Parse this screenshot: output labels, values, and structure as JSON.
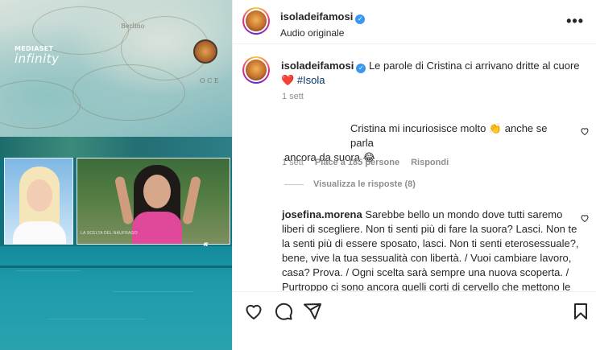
{
  "media": {
    "mediaset_line1": "MEDIASET",
    "mediaset_line2": "infinity",
    "caption_small": "LA SCELTA DEL NAUFRAGO",
    "channel": "5",
    "map_words": [
      "O C E",
      "Berlino"
    ]
  },
  "header": {
    "username": "isoladeifamosi",
    "subtitle": "Audio originale",
    "more_label": "•••"
  },
  "post_caption": {
    "username": "isoladeifamosi",
    "text": "Le parole di Cristina ci arrivano dritte al cuore",
    "heart": "❤️",
    "hashtag": "#Isola",
    "time": "1 sett"
  },
  "comment1": {
    "line1": "Cristina mi incuriosisce molto 👏 anche se parla",
    "line2": "ancora da suora 😂",
    "time": "1 sett",
    "likes": "Piace a 185 persone",
    "reply": "Rispondi",
    "view_replies": "Visualizza le risposte (8)"
  },
  "comment2": {
    "username": "josefina.morena",
    "line1": "Sarebbe bello un mondo dove tutti saremo",
    "line2": "liberi di scegliere. Non ti senti più di fare la suora? Lasci. Non te",
    "line3": "la senti più di essere sposato, lasci. Non ti senti eterosessuale?,",
    "line4": "bene, vive la tua sessualità con libertà. / Vuoi cambiare lavoro,",
    "line5": "casa? Prova. / Ogni scelta sarà sempre una nuova scoperta. /",
    "line6": "Purtroppo ci sono ancora quelli corti di cervello che mettono le"
  },
  "colors": {
    "link_blue": "#00376b",
    "verified_blue": "#3897f0",
    "heart_red": "#ed4956",
    "meta_grey": "#8e8e8e"
  },
  "icons": [
    "heart-icon",
    "comment-icon",
    "share-icon",
    "bookmark-icon",
    "more-icon",
    "verified-icon"
  ]
}
